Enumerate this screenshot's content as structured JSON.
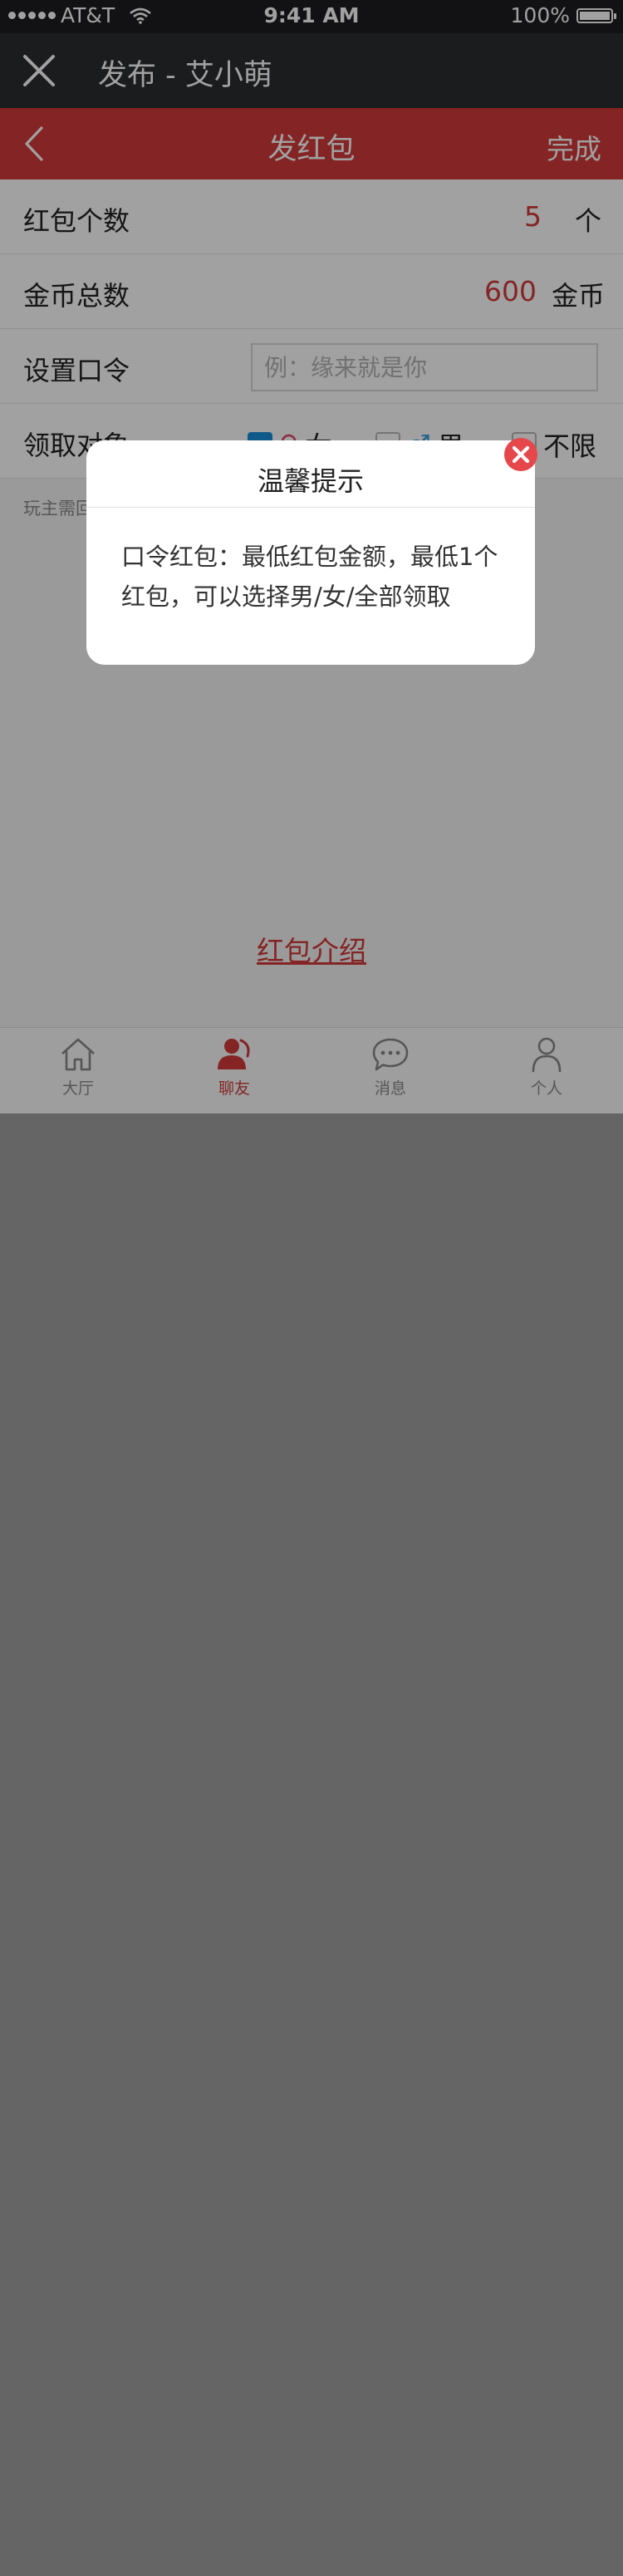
{
  "status_bar": {
    "carrier": "AT&T",
    "time": "9:41 AM",
    "battery": "100%",
    "battery_level": 1.0
  },
  "header": {
    "title": "发布 - 艾小萌",
    "close_icon": "close-icon"
  },
  "nav": {
    "title": "发红包",
    "done_label": "完成",
    "back_icon": "chevron-left-icon"
  },
  "form": {
    "count": {
      "label": "红包个数",
      "value": "5",
      "unit": "个"
    },
    "coins": {
      "label": "金币总数",
      "value": "600",
      "unit": "金币"
    },
    "password": {
      "label": "设置口令",
      "placeholder": "例：缘来就是你"
    },
    "target": {
      "label": "领取对象",
      "options": [
        {
          "symbol": "♀",
          "label": "女",
          "checked": true
        },
        {
          "symbol": "♂",
          "label": "男",
          "checked": false
        },
        {
          "symbol": "",
          "label": "不限",
          "checked": false
        }
      ]
    },
    "note": "玩主需回"
  },
  "intro_link": "红包介绍",
  "tabs": [
    {
      "label": "大厅",
      "icon": "home-icon",
      "active": false
    },
    {
      "label": "聊友",
      "icon": "chat-friends-icon",
      "active": true
    },
    {
      "label": "消息",
      "icon": "message-icon",
      "active": false
    },
    {
      "label": "个人",
      "icon": "person-icon",
      "active": false
    }
  ],
  "modal": {
    "title": "温馨提示",
    "body": "口令红包：最低红包金额，最低1个红包，可以选择男/女/全部领取",
    "close_icon": "close-circle-icon"
  },
  "colors": {
    "accent": "#d23a3a",
    "header_bg": "#2b2d30",
    "checkbox_checked": "#1a8fd9"
  }
}
